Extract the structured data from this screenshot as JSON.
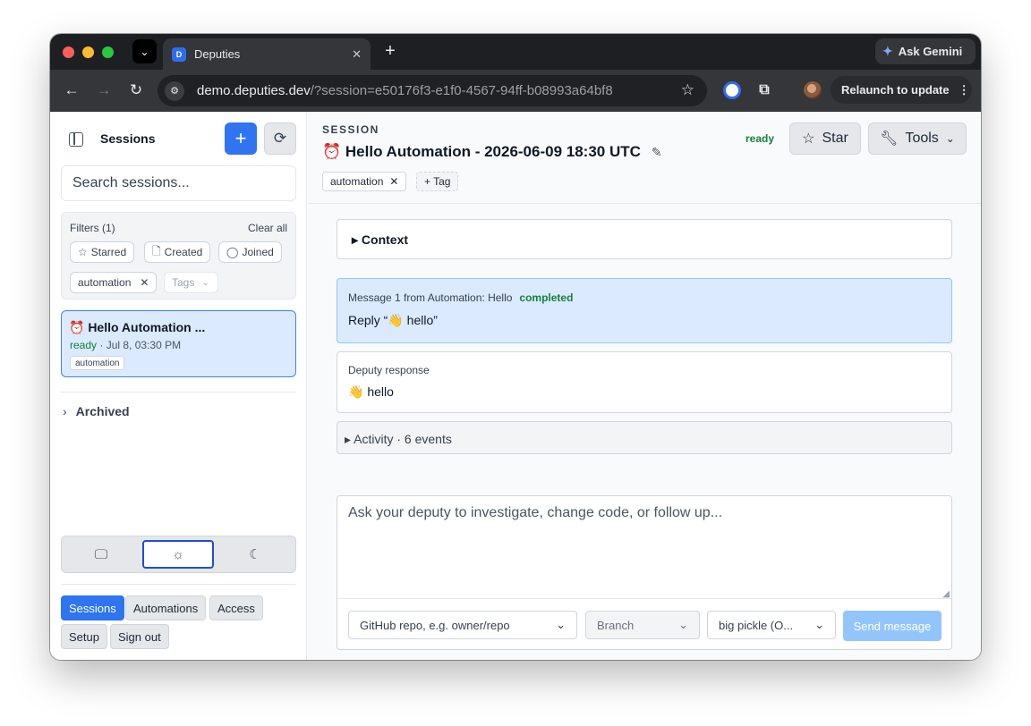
{
  "browser": {
    "tab_title": "Deputies",
    "tab_favicon": "D",
    "ask_gemini": "Ask Gemini",
    "url_host": "demo.deputies.dev",
    "url_rest": "/?session=e50176f3-e1f0-4567-94ff-b08993a64bf8",
    "relaunch": "Relaunch to update"
  },
  "sidebar": {
    "title": "Sessions",
    "search_placeholder": "Search sessions...",
    "filters_title": "Filters (1)",
    "clear_all": "Clear all",
    "filter_chips": [
      "Starred",
      "Created",
      "Joined"
    ],
    "active_tag": "automation",
    "tags_placeholder": "Tags",
    "session": {
      "title": "⏰ Hello Automation ...",
      "status": "ready",
      "meta": " · Jul 8, 03:30 PM",
      "tag": "automation"
    },
    "archived": "Archived",
    "nav": [
      "Sessions",
      "Automations",
      "Access",
      "Setup",
      "Sign out"
    ]
  },
  "main": {
    "label": "SESSION",
    "title": "⏰ Hello Automation - 2026-06-09 18:30 UTC",
    "tags": [
      "automation"
    ],
    "add_tag": "+ Tag",
    "status": "ready",
    "star": "Star",
    "tools": "Tools",
    "context": "Context",
    "message": {
      "head": "Message 1 from Automation: Hello",
      "status": "completed",
      "body": "Reply “👋 hello”"
    },
    "response": {
      "head": "Deputy response",
      "body": "👋 hello"
    },
    "activity": "Activity · 6 events",
    "composer": {
      "placeholder": "Ask your deputy to investigate, change code, or follow up...",
      "repo_placeholder": "GitHub repo, e.g. owner/repo",
      "branch": "Branch",
      "model": "big pickle (O...",
      "send": "Send message"
    }
  },
  "colors": {
    "accent": "#2f74f0",
    "status_green": "#15803d",
    "selected_bg": "#dbeafe"
  }
}
